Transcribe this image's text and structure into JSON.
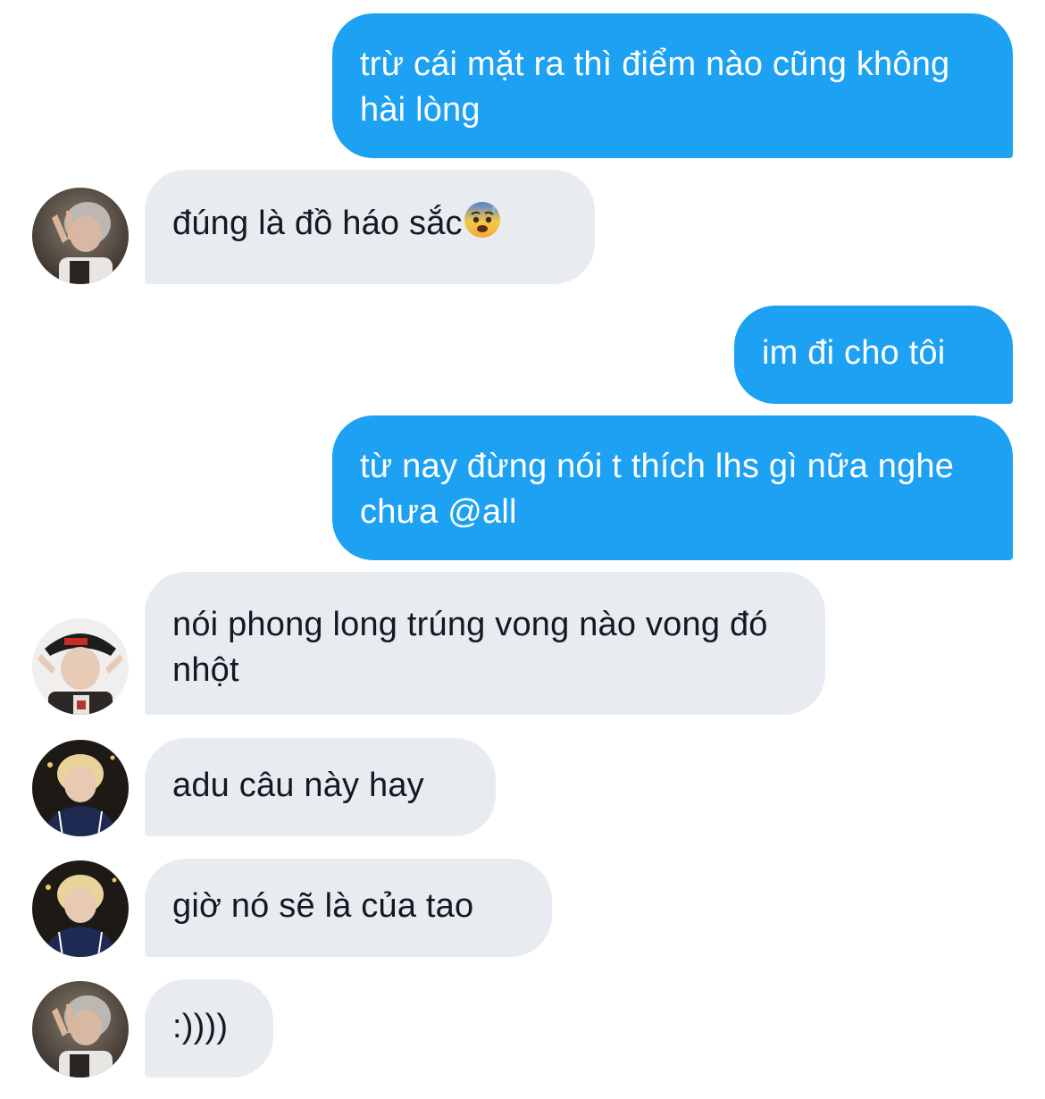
{
  "chat": {
    "messages": [
      {
        "side": "outgoing",
        "text": "trừ cái mặt ra thì điểm nào cũng không hài lòng"
      },
      {
        "side": "incoming",
        "sender_avatar": "avatar-a",
        "text": "đúng là đồ háo sắc",
        "emoji": "anxious-face-with-sweat-emoji"
      },
      {
        "side": "outgoing",
        "text": "im đi cho tôi"
      },
      {
        "side": "outgoing",
        "text": "từ nay đừng nói t thích lhs gì nữa nghe chưa @all"
      },
      {
        "side": "incoming",
        "sender_avatar": "avatar-b",
        "text": "nói phong long trúng vong nào vong đó nhột"
      },
      {
        "side": "incoming",
        "sender_avatar": "avatar-c",
        "text": "adu câu này hay"
      },
      {
        "side": "incoming",
        "sender_avatar": "avatar-c",
        "text": "giờ nó sẽ là của tao"
      },
      {
        "side": "incoming",
        "sender_avatar": "avatar-a",
        "text": ":))))"
      }
    ]
  },
  "colors": {
    "outgoing_bubble": "#1da1f2",
    "incoming_bubble": "#e8ecf0",
    "outgoing_text": "#ffffff",
    "incoming_text": "#141823"
  }
}
